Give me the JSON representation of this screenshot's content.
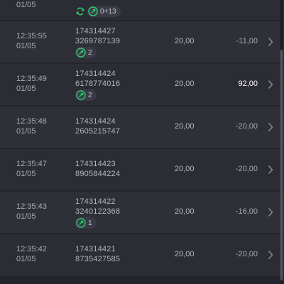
{
  "rows": [
    {
      "time": "",
      "date": "01/05",
      "id_line1": "",
      "id_line2": "",
      "badge_count": "0+13",
      "stake": "",
      "result": ""
    },
    {
      "time": "12:35:55",
      "date": "01/05",
      "id_line1": "174314427",
      "id_line2": "3269787139",
      "badge_count": "2",
      "stake": "20,00",
      "result": "-11,00"
    },
    {
      "time": "12:35:49",
      "date": "01/05",
      "id_line1": "174314424",
      "id_line2": "6178774016",
      "badge_count": "2",
      "stake": "20,00",
      "result": "92,00"
    },
    {
      "time": "12:35:48",
      "date": "01/05",
      "id_line1": "174314424",
      "id_line2": "2605215747",
      "stake": "20,00",
      "result": "-20,00"
    },
    {
      "time": "12:35:47",
      "date": "01/05",
      "id_line1": "174314423",
      "id_line2": "8905844224",
      "stake": "20,00",
      "result": "-20,00"
    },
    {
      "time": "12:35:43",
      "date": "01/05",
      "id_line1": "174314422",
      "id_line2": "3240122368",
      "badge_count": "1",
      "stake": "20,00",
      "result": "-16,00"
    },
    {
      "time": "12:35:42",
      "date": "01/05",
      "id_line1": "174314421",
      "id_line2": "8735427585",
      "stake": "20,00",
      "result": "-20,00"
    }
  ],
  "colors": {
    "background": "#24242c",
    "row": "#2f2f38",
    "positive_result": "#ffffff",
    "badge_icon": "#2ecc71"
  },
  "icons": [
    "refresh-icon",
    "swap-icon",
    "chevron-right-icon"
  ]
}
